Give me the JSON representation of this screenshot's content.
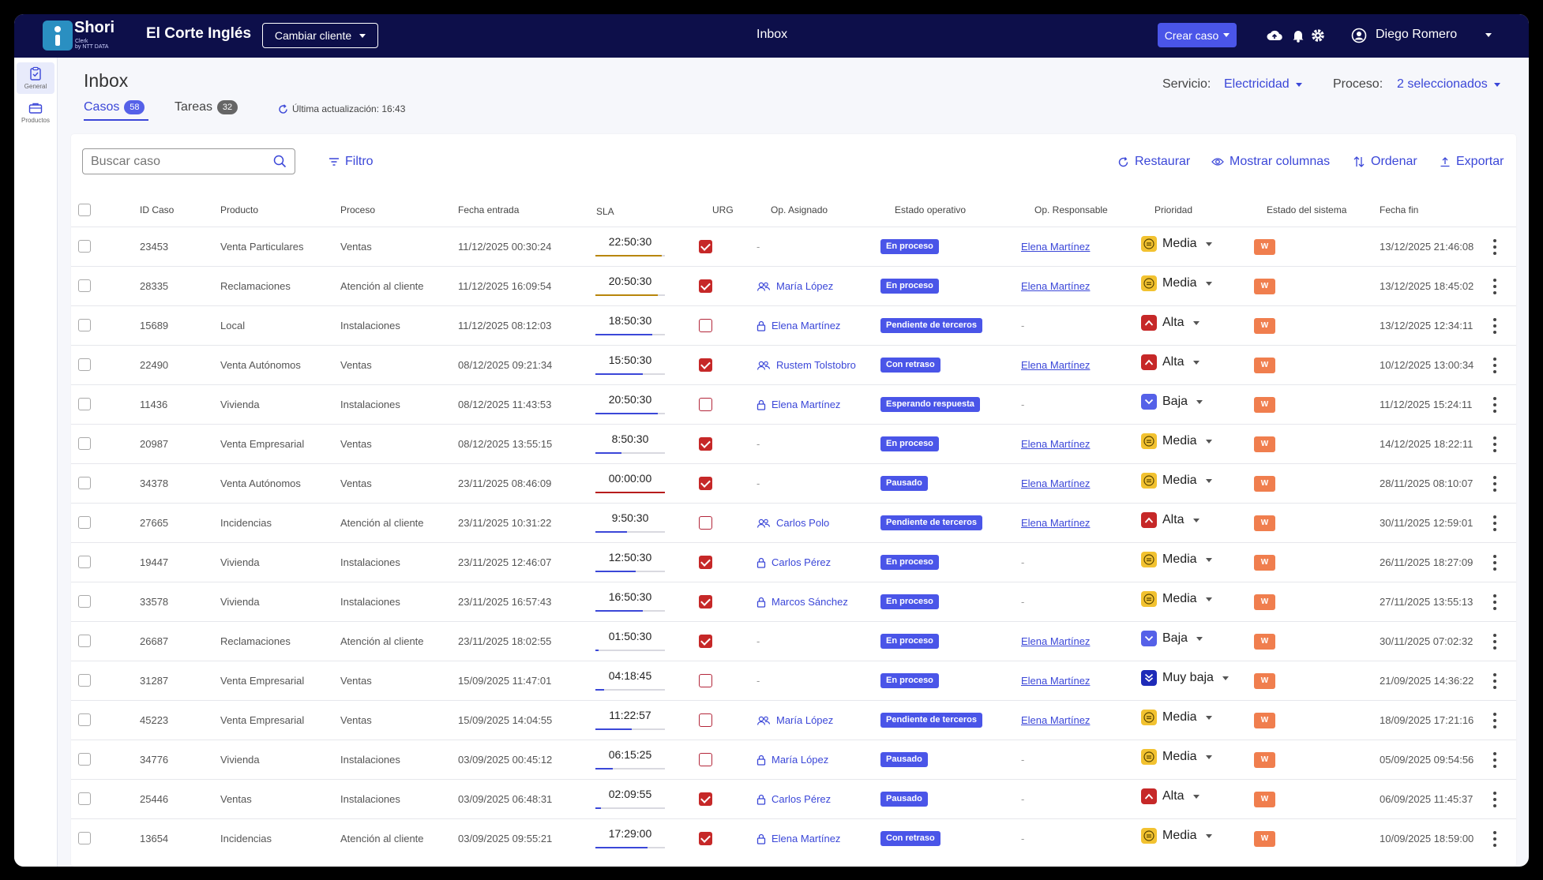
{
  "app": {
    "logo_text": "Shori",
    "logo_sub_1": "Clerk",
    "logo_sub_2": "by NTT DATA",
    "client_name": "El Corte Inglés",
    "change_client_label": "Cambiar cliente",
    "title": "Inbox",
    "create_case_label": "Crear caso",
    "user_name": "Diego Romero"
  },
  "sidebar": {
    "items": [
      {
        "label": "General"
      },
      {
        "label": "Productos"
      }
    ]
  },
  "page": {
    "title": "Inbox",
    "tabs": [
      {
        "label": "Casos",
        "count": "58"
      },
      {
        "label": "Tareas",
        "count": "32"
      }
    ],
    "last_update": "Última actualización: 16:43",
    "service_label": "Servicio:",
    "service_value": "Electricidad",
    "process_label": "Proceso:",
    "process_value": "2 seleccionados"
  },
  "toolbar": {
    "search_placeholder": "Buscar caso",
    "filter_label": "Filtro",
    "restore_label": "Restaurar",
    "columns_label": "Mostrar columnas",
    "sort_label": "Ordenar",
    "export_label": "Exportar"
  },
  "table": {
    "headers": [
      "ID Caso",
      "Producto",
      "Proceso",
      "Fecha entrada",
      "SLA",
      "URG",
      "Op. Asignado",
      "Estado operativo",
      "Op. Responsable",
      "Prioridad",
      "Estado del sistema",
      "Fecha fin"
    ],
    "rows": [
      {
        "id": "23453",
        "producto": "Venta Particulares",
        "proceso": "Ventas",
        "entrada": "11/12/2025 00:30:24",
        "sla": "22:50:30",
        "sla_pct": 0.95,
        "sla_color": "#b8860b",
        "urg": true,
        "op": "-",
        "op_icon": "none",
        "estado": "En proceso",
        "resp": "Elena Martínez",
        "prio": "Media",
        "sys": "W",
        "fin": "13/12/2025 21:46:08"
      },
      {
        "id": "28335",
        "producto": "Reclamaciones",
        "proceso": "Atención al cliente",
        "entrada": "11/12/2025 16:09:54",
        "sla": "20:50:30",
        "sla_pct": 0.9,
        "sla_color": "#b8860b",
        "urg": true,
        "op": "María López",
        "op_icon": "group",
        "estado": "En proceso",
        "resp": "Elena Martínez",
        "prio": "Media",
        "sys": "W",
        "fin": "13/12/2025 18:45:02"
      },
      {
        "id": "15689",
        "producto": "Local",
        "proceso": "Instalaciones",
        "entrada": "11/12/2025 08:12:03",
        "sla": "18:50:30",
        "sla_pct": 0.82,
        "sla_color": "#3b47d8",
        "urg": false,
        "op": "Elena Martínez",
        "op_icon": "lock",
        "estado": "Pendiente de terceros",
        "resp": "-",
        "prio": "Alta",
        "sys": "W",
        "fin": "13/12/2025 12:34:11"
      },
      {
        "id": "22490",
        "producto": "Venta Autónomos",
        "proceso": "Ventas",
        "entrada": "08/12/2025 09:21:34",
        "sla": "15:50:30",
        "sla_pct": 0.68,
        "sla_color": "#3b47d8",
        "urg": true,
        "op": "Rustem Tolstobro",
        "op_icon": "group",
        "estado": "Con retraso",
        "resp": "Elena Martínez",
        "prio": "Alta",
        "sys": "W",
        "fin": "10/12/2025 13:00:34"
      },
      {
        "id": "11436",
        "producto": "Vivienda",
        "proceso": "Instalaciones",
        "entrada": "08/12/2025 11:43:53",
        "sla": "20:50:30",
        "sla_pct": 0.9,
        "sla_color": "#3b47d8",
        "urg": false,
        "op": "Elena Martínez",
        "op_icon": "lock",
        "estado": "Esperando respuesta",
        "resp": "-",
        "prio": "Baja",
        "sys": "W",
        "fin": "11/12/2025 15:24:11"
      },
      {
        "id": "20987",
        "producto": "Venta Empresarial",
        "proceso": "Ventas",
        "entrada": "08/12/2025 13:55:15",
        "sla": "8:50:30",
        "sla_pct": 0.38,
        "sla_color": "#3b47d8",
        "urg": true,
        "op": "-",
        "op_icon": "none",
        "estado": "En proceso",
        "resp": "Elena Martínez",
        "prio": "Media",
        "sys": "W",
        "fin": "14/12/2025 18:22:11"
      },
      {
        "id": "34378",
        "producto": "Venta Autónomos",
        "proceso": "Ventas",
        "entrada": "23/11/2025 08:46:09",
        "sla": "00:00:00",
        "sla_pct": 1.0,
        "sla_color": "#b71c1c",
        "urg": true,
        "op": "-",
        "op_icon": "none",
        "estado": "Pausado",
        "resp": "Elena Martínez",
        "prio": "Media",
        "sys": "W",
        "fin": "28/11/2025 08:10:07"
      },
      {
        "id": "27665",
        "producto": "Incidencias",
        "proceso": "Atención al cliente",
        "entrada": "23/11/2025 10:31:22",
        "sla": "9:50:30",
        "sla_pct": 0.45,
        "sla_color": "#3b47d8",
        "urg": false,
        "op": "Carlos Polo",
        "op_icon": "group",
        "estado": "Pendiente de terceros",
        "resp": "Elena Martínez",
        "prio": "Alta",
        "sys": "W",
        "fin": "30/11/2025 12:59:01"
      },
      {
        "id": "19447",
        "producto": "Vivienda",
        "proceso": "Instalaciones",
        "entrada": "23/11/2025 12:46:07",
        "sla": "12:50:30",
        "sla_pct": 0.58,
        "sla_color": "#3b47d8",
        "urg": true,
        "op": "Carlos Pérez",
        "op_icon": "lock",
        "estado": "En proceso",
        "resp": "-",
        "prio": "Media",
        "sys": "W",
        "fin": "26/11/2025 18:27:09"
      },
      {
        "id": "33578",
        "producto": "Vivienda",
        "proceso": "Instalaciones",
        "entrada": "23/11/2025 16:57:43",
        "sla": "16:50:30",
        "sla_pct": 0.68,
        "sla_color": "#3b47d8",
        "urg": true,
        "op": "Marcos Sánchez",
        "op_icon": "lock",
        "estado": "En proceso",
        "resp": "-",
        "prio": "Media",
        "sys": "W",
        "fin": "27/11/2025 13:55:13"
      },
      {
        "id": "26687",
        "producto": "Reclamaciones",
        "proceso": "Atención al cliente",
        "entrada": "23/11/2025 18:02:55",
        "sla": "01:50:30",
        "sla_pct": 0.05,
        "sla_color": "#3b47d8",
        "urg": true,
        "op": "-",
        "op_icon": "none",
        "estado": "En proceso",
        "resp": "Elena Martínez",
        "prio": "Baja",
        "sys": "W",
        "fin": "30/11/2025 07:02:32"
      },
      {
        "id": "31287",
        "producto": "Venta Empresarial",
        "proceso": "Ventas",
        "entrada": "15/09/2025 11:47:01",
        "sla": "04:18:45",
        "sla_pct": 0.12,
        "sla_color": "#3b47d8",
        "urg": false,
        "op": "-",
        "op_icon": "none",
        "estado": "En proceso",
        "resp": "Elena Martínez",
        "prio": "Muy baja",
        "sys": "W",
        "fin": "21/09/2025 14:36:22"
      },
      {
        "id": "45223",
        "producto": "Venta Empresarial",
        "proceso": "Ventas",
        "entrada": "15/09/2025 14:04:55",
        "sla": "11:22:57",
        "sla_pct": 0.52,
        "sla_color": "#3b47d8",
        "urg": false,
        "op": "María López",
        "op_icon": "group",
        "estado": "Pendiente de terceros",
        "resp": "Elena Martínez",
        "prio": "Media",
        "sys": "W",
        "fin": "18/09/2025 17:21:16"
      },
      {
        "id": "34776",
        "producto": "Vivienda",
        "proceso": "Instalaciones",
        "entrada": "03/09/2025 00:45:12",
        "sla": "06:15:25",
        "sla_pct": 0.25,
        "sla_color": "#3b47d8",
        "urg": false,
        "op": "María López",
        "op_icon": "lock",
        "estado": "Pausado",
        "resp": "-",
        "prio": "Media",
        "sys": "W",
        "fin": "05/09/2025 09:54:56"
      },
      {
        "id": "25446",
        "producto": "Ventas",
        "proceso": "Instalaciones",
        "entrada": "03/09/2025 06:48:31",
        "sla": "02:09:55",
        "sla_pct": 0.08,
        "sla_color": "#3b47d8",
        "urg": true,
        "op": "Carlos Pérez",
        "op_icon": "lock",
        "estado": "Pausado",
        "resp": "-",
        "prio": "Alta",
        "sys": "W",
        "fin": "06/09/2025 11:45:37"
      },
      {
        "id": "13654",
        "producto": "Incidencias",
        "proceso": "Atención al cliente",
        "entrada": "03/09/2025 09:55:21",
        "sla": "17:29:00",
        "sla_pct": 0.75,
        "sla_color": "#3b47d8",
        "urg": true,
        "op": "Elena Martínez",
        "op_icon": "lock",
        "estado": "Con retraso",
        "resp": "-",
        "prio": "Media",
        "sys": "W",
        "fin": "10/09/2025 18:59:00"
      }
    ]
  },
  "colors": {
    "topbar": "#0d0f4a",
    "accent": "#3b47d8",
    "urgent": "#c62828",
    "system_badge": "#f07e4e"
  }
}
